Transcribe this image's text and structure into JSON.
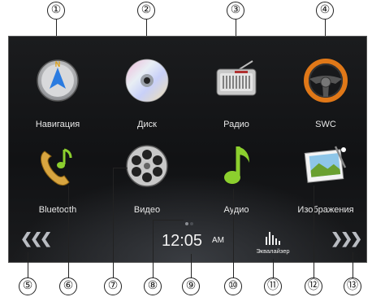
{
  "apps": [
    {
      "label": "Навигация",
      "icon": "navigation-compass-icon"
    },
    {
      "label": "Диск",
      "icon": "disc-icon"
    },
    {
      "label": "Радио",
      "icon": "radio-icon"
    },
    {
      "label": "SWC",
      "icon": "steering-wheel-icon"
    },
    {
      "label": "Bluetooth",
      "icon": "phone-music-icon"
    },
    {
      "label": "Видео",
      "icon": "film-reel-icon"
    },
    {
      "label": "Аудио",
      "icon": "music-note-icon"
    },
    {
      "label": "Изображения",
      "icon": "photo-icon"
    }
  ],
  "status": {
    "time": "12:05",
    "ampm": "AM",
    "equalizer_label": "Эквалайзер"
  },
  "callouts": [
    "①",
    "②",
    "③",
    "④",
    "⑤",
    "⑥",
    "⑦",
    "⑧",
    "⑨",
    "⑩",
    "⑪",
    "⑫",
    "⑬"
  ],
  "page_indicator": {
    "pages": 2,
    "active": 0
  },
  "colors": {
    "screen_bg": "#141517",
    "label_text": "#e8e8e8",
    "nav_blue": "#2a7be0",
    "note_green": "#8ccf2e"
  }
}
